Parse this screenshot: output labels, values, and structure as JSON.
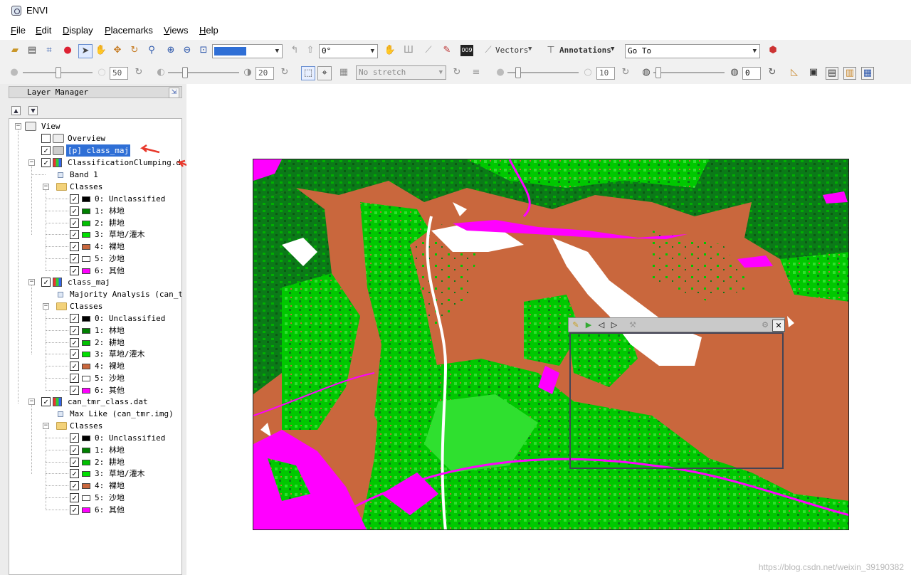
{
  "window": {
    "title": "ENVI"
  },
  "menu": [
    "File",
    "Edit",
    "Display",
    "Placemarks",
    "Views",
    "Help"
  ],
  "toolbar": {
    "rotation": "0°",
    "vectors": "Vectors",
    "annotations": "Annotations",
    "goto": "Go To",
    "brightness": "50",
    "contrast": "20",
    "stretch": "No stretch",
    "sharpen": "10",
    "transparency": "0"
  },
  "layer_manager": {
    "title": "Layer Manager",
    "view_label": "View",
    "overview_label": "Overview",
    "selected_layer": "[p] class_maj",
    "classes_label": "Classes",
    "groups": [
      {
        "name": "ClassificationClumping.dat",
        "band": "Band 1",
        "classes": [
          {
            "label": "0: Unclassified",
            "color": "#000000"
          },
          {
            "label": "1: 林地",
            "color": "#008000"
          },
          {
            "label": "2: 耕地",
            "color": "#00c000"
          },
          {
            "label": "3: 草地/灌木",
            "color": "#00e000"
          },
          {
            "label": "4: 裸地",
            "color": "#c9673d"
          },
          {
            "label": "5: 沙地",
            "color": "#ffffff"
          },
          {
            "label": "6: 其他",
            "color": "#ff00ff"
          }
        ]
      },
      {
        "name": "class_maj",
        "band": "Majority Analysis (can_tm",
        "classes": [
          {
            "label": "0: Unclassified",
            "color": "#000000"
          },
          {
            "label": "1: 林地",
            "color": "#008000"
          },
          {
            "label": "2: 耕地",
            "color": "#00c000"
          },
          {
            "label": "3: 草地/灌木",
            "color": "#00e000"
          },
          {
            "label": "4: 裸地",
            "color": "#c9673d"
          },
          {
            "label": "5: 沙地",
            "color": "#ffffff"
          },
          {
            "label": "6: 其他",
            "color": "#ff00ff"
          }
        ]
      },
      {
        "name": "can_tmr_class.dat",
        "band": "Max Like (can_tmr.img)",
        "classes": [
          {
            "label": "0: Unclassified",
            "color": "#000000"
          },
          {
            "label": "1: 林地",
            "color": "#008000"
          },
          {
            "label": "2: 耕地",
            "color": "#00c000"
          },
          {
            "label": "3: 草地/灌木",
            "color": "#00e000"
          },
          {
            "label": "4: 裸地",
            "color": "#c9673d"
          },
          {
            "label": "5: 沙地",
            "color": "#ffffff"
          },
          {
            "label": "6: 其他",
            "color": "#ff00ff"
          }
        ]
      }
    ]
  },
  "watermark": "https://blog.csdn.net/weixin_39190382",
  "colors": {
    "bare": "#c9673d",
    "forest": "#0b7a18",
    "crop": "#00c800",
    "grass": "#2fe02f",
    "sand": "#ffffff",
    "other": "#ff00ff",
    "selection": "#2f6fd6",
    "arrow": "#e8392c"
  }
}
